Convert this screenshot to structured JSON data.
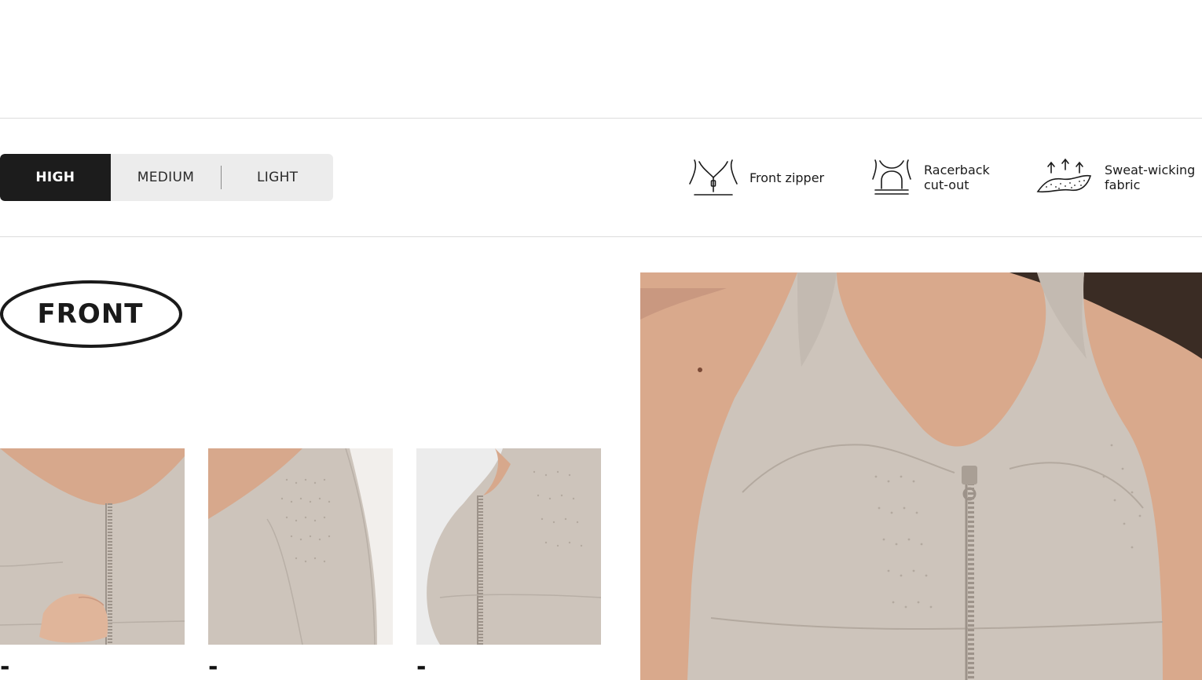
{
  "intensity": {
    "options": [
      "HIGH",
      "MEDIUM",
      "LIGHT"
    ],
    "selected": "HIGH"
  },
  "features": [
    {
      "icon": "front-zipper-icon",
      "label": "Front zipper"
    },
    {
      "icon": "racerback-icon",
      "label": "Racerback\ncut-out"
    },
    {
      "icon": "sweat-wicking-icon",
      "label": "Sweat-wicking\nfabric"
    }
  ],
  "section": {
    "badge": "FRONT"
  },
  "thumbnails": [
    {
      "image": "zipper-detail-photo",
      "caption": "-"
    },
    {
      "image": "perforated-panel-photo",
      "caption": "-"
    },
    {
      "image": "side-profile-photo",
      "caption": "-"
    }
  ],
  "hero": {
    "image": "model-front-photo"
  },
  "colors": {
    "accent": "#1c1c1c",
    "selector_bg": "#ececec",
    "fabric": "#cdc4bb",
    "skin": "#d9a98c",
    "divider": "#dcdcdc"
  }
}
